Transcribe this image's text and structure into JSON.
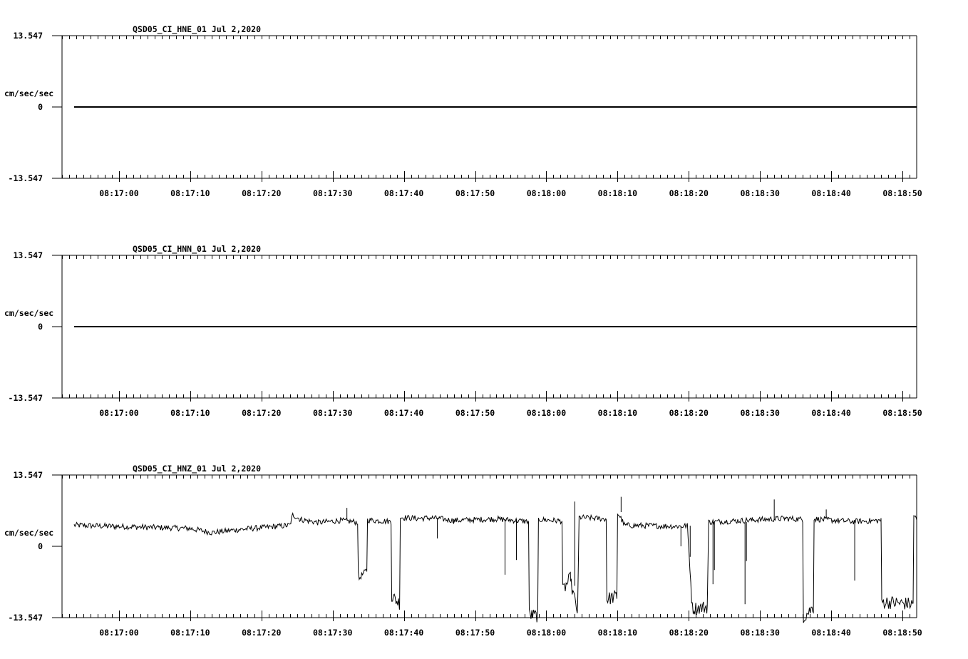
{
  "chart_data": [
    {
      "type": "line",
      "title": "QSD05_CI_HNE_01  Jul 2,2020",
      "ylabel": "cm/sec/sec",
      "ylim": [
        -13.547,
        13.547
      ],
      "ytick_labels": [
        "13.547",
        "0",
        "-13.547"
      ],
      "xtick_labels": [
        "08:17:00",
        "08:17:10",
        "08:17:20",
        "08:17:30",
        "08:17:40",
        "08:17:50",
        "08:18:00",
        "08:18:10",
        "08:18:20",
        "08:18:30",
        "08:18:40",
        "08:18:50"
      ],
      "xlim_seconds": [
        -8,
        112
      ],
      "series": [
        {
          "x_start_seconds": -6.3,
          "x_end_seconds": 112,
          "values": [
            0,
            0
          ]
        }
      ]
    },
    {
      "type": "line",
      "title": "QSD05_CI_HNN_01  Jul 2,2020",
      "ylabel": "cm/sec/sec",
      "ylim": [
        -13.547,
        13.547
      ],
      "ytick_labels": [
        "13.547",
        "0",
        "-13.547"
      ],
      "xtick_labels": [
        "08:17:00",
        "08:17:10",
        "08:17:20",
        "08:17:30",
        "08:17:40",
        "08:17:50",
        "08:18:00",
        "08:18:10",
        "08:18:20",
        "08:18:30",
        "08:18:40",
        "08:18:50"
      ],
      "xlim_seconds": [
        -8,
        112
      ],
      "series": [
        {
          "x_start_seconds": -6.3,
          "x_end_seconds": 112,
          "values": [
            0,
            0
          ]
        }
      ]
    },
    {
      "type": "line",
      "title": "QSD05_CI_HNZ_01  Jul 2,2020",
      "ylabel": "cm/sec/sec",
      "ylim": [
        -13.547,
        13.547
      ],
      "ytick_labels": [
        "13.547",
        "0",
        "-13.547"
      ],
      "xtick_labels": [
        "08:17:00",
        "08:17:10",
        "08:17:20",
        "08:17:30",
        "08:17:40",
        "08:17:50",
        "08:18:00",
        "08:18:10",
        "08:18:20",
        "08:18:30",
        "08:18:40",
        "08:18:50"
      ],
      "xlim_seconds": [
        -8,
        112
      ],
      "series": [
        {
          "levels": [
            [
              -6.3,
              4.0
            ],
            [
              2.0,
              3.7
            ],
            [
              10.0,
              3.4
            ],
            [
              13.0,
              2.6
            ],
            [
              17.0,
              3.2
            ],
            [
              24.0,
              4.0
            ],
            [
              24.4,
              6.0
            ],
            [
              25.5,
              5.1
            ],
            [
              28.0,
              4.5
            ],
            [
              31.0,
              4.9
            ],
            [
              33.5,
              4.6
            ],
            [
              33.6,
              -6.2
            ],
            [
              34.8,
              -4.5
            ],
            [
              34.9,
              5.0
            ],
            [
              38.2,
              4.7
            ],
            [
              38.3,
              -9.5
            ],
            [
              39.4,
              -10.8
            ],
            [
              39.5,
              5.5
            ],
            [
              42.0,
              5.3
            ],
            [
              44.0,
              5.4
            ],
            [
              47.0,
              4.9
            ],
            [
              53.0,
              5.2
            ],
            [
              57.5,
              4.7
            ],
            [
              57.6,
              -13.0
            ],
            [
              58.8,
              -13.2
            ],
            [
              58.9,
              5.1
            ],
            [
              62.2,
              4.8
            ],
            [
              62.3,
              -8.5
            ],
            [
              63.4,
              -6.0
            ],
            [
              63.5,
              -7.5
            ],
            [
              64.4,
              -12.5
            ],
            [
              64.6,
              5.5
            ],
            [
              68.4,
              5.2
            ],
            [
              68.5,
              -10.0
            ],
            [
              69.9,
              -9.5
            ],
            [
              70.0,
              6.5
            ],
            [
              71.0,
              4.0
            ],
            [
              78.5,
              3.8
            ],
            [
              79.8,
              3.9
            ],
            [
              80.5,
              -11.8
            ],
            [
              82.6,
              -11.5
            ],
            [
              82.8,
              4.6
            ],
            [
              89.0,
              5.0
            ],
            [
              93.5,
              5.3
            ],
            [
              96.0,
              5.1
            ],
            [
              96.1,
              -13.5
            ],
            [
              97.5,
              -11.5
            ],
            [
              97.6,
              5.2
            ],
            [
              103.0,
              4.7
            ],
            [
              107.0,
              4.9
            ],
            [
              107.1,
              -10.5
            ],
            [
              111.5,
              -11.0
            ],
            [
              111.6,
              6.0
            ],
            [
              112.0,
              5.0
            ]
          ],
          "spikes": [
            [
              44.7,
              1.5
            ],
            [
              54.2,
              -5.4
            ],
            [
              55.8,
              -2.6
            ],
            [
              78.9,
              0.0
            ],
            [
              80.2,
              -2.0
            ],
            [
              83.4,
              -7.2
            ],
            [
              83.6,
              -4.5
            ],
            [
              87.9,
              -11.0
            ],
            [
              88.1,
              -2.8
            ],
            [
              92.0,
              8.9
            ],
            [
              99.3,
              7.0
            ],
            [
              103.3,
              -6.5
            ],
            [
              64.0,
              8.5
            ],
            [
              70.5,
              9.4
            ],
            [
              32.0,
              7.3
            ]
          ]
        }
      ]
    }
  ]
}
